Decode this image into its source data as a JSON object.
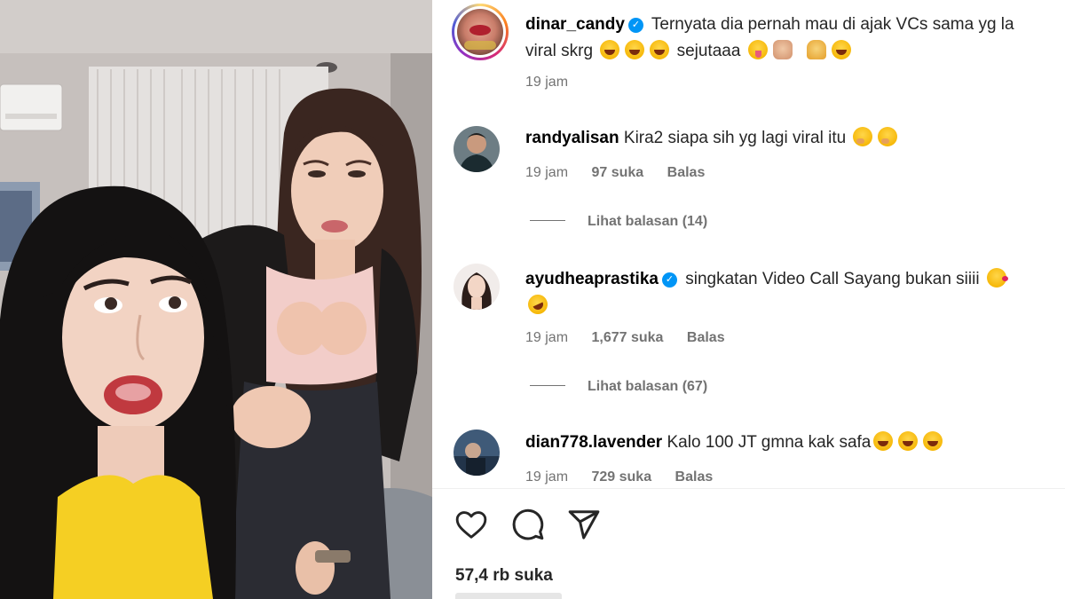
{
  "post": {
    "author": "dinar_candy",
    "caption_line1": "Ternyata dia pernah mau di ajak VCs sama yg la",
    "caption_line2": "viral skrg",
    "caption_word": "sejutaaa",
    "time": "19 jam",
    "likes": "57,4 rb suka"
  },
  "comments": [
    {
      "username": "randyalisan",
      "verified": false,
      "text": "Kira2 siapa sih yg lagi viral itu",
      "time": "19 jam",
      "likes": "97 suka",
      "reply": "Balas",
      "view_replies": "Lihat balasan (14)"
    },
    {
      "username": "ayudheaprastika",
      "verified": true,
      "text": "singkatan Video Call Sayang bukan siiii",
      "time": "19 jam",
      "likes": "1,677 suka",
      "reply": "Balas",
      "view_replies": "Lihat balasan (67)"
    },
    {
      "username": "dian778.lavender",
      "verified": false,
      "text": "Kalo 100 JT gmna kak safa",
      "time": "19 jam",
      "likes": "729 suka",
      "reply": "Balas"
    }
  ],
  "icons": {
    "like": "heart-icon",
    "comment": "comment-icon",
    "share": "share-icon",
    "verified": "verified-badge-icon"
  },
  "colors": {
    "verified": "#0095f6",
    "secondary_text": "#737373",
    "primary_text": "#262626"
  }
}
